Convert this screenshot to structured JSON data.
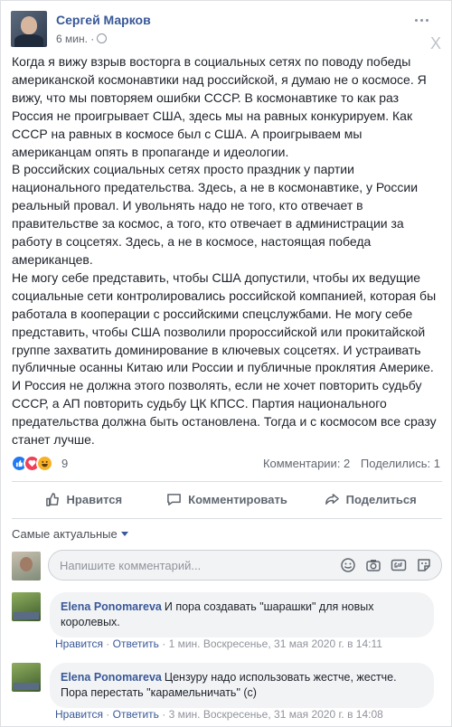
{
  "post": {
    "author": "Сергей Марков",
    "time": "6 мин. ·",
    "text": "Когда я вижу взрыв восторга в социальных сетях по поводу победы\nамериканской космонавтики над российской, я думаю не о космосе. Я\nвижу, что мы повторяем ошибки СССР. В космонавтике то как раз\nРоссия не проигрывает США, здесь мы на равных конкурируем. Как\nСССР на равных в космосе был с США. А проигрываем мы\nамериканцам опять в пропаганде и идеологии.\nВ российских социальных сетях просто праздник у партии\nнационального предательства. Здесь, а не в космонавтике, у России\nреальный провал. И увольнять надо не того, кто отвечает в\nправительстве за космос, а того, кто отвечает в администрации за\nработу в соцсетях. Здесь, а не в космосе, настоящая победа\nамериканцев.\nНе могу себе представить, чтобы США допустили, чтобы их ведущие\nсоциальные сети контролировались российской компанией, которая бы\nработала в кооперации с российскими спецслужбами. Не могу себе\nпредставить, чтобы США позволили пророссийской или прокитайской\nгруппе захватить доминирование в ключевых соцсетях. И устраивать\nпубличные осанны Китаю или России и публичные проклятия Америке.\nИ Россия не должна этого позволять, если не хочет повторить судьбу\nСССР, а АП повторить судьбу ЦК КПСС. Партия национального\nпредательства должна быть остановлена. Тогда и с космосом все сразу\nстанет лучше.",
    "close_glyph": "X",
    "reaction_count": "9",
    "comments_count": "Комментарии: 2",
    "shares_count": "Поделились: 1"
  },
  "actions": {
    "like": "Нравится",
    "comment": "Комментировать",
    "share": "Поделиться"
  },
  "comments_section": {
    "sort_label": "Самые актуальные",
    "input_placeholder": "Напишите комментарий..."
  },
  "comments": [
    {
      "author": "Elena Ponomareva",
      "text": "И пора создавать \"шарашки\" для новых королевых.",
      "like": "Нравится",
      "reply": "Ответить",
      "meta": "1 мин. Воскресенье, 31 мая 2020 г. в 14:11"
    },
    {
      "author": "Elena Ponomareva",
      "text": "Цензуру надо использовать жестче, жестче. Пора перестать \"карамельничать\" (с)",
      "like": "Нравится",
      "reply": "Ответить",
      "meta": "3 мин. Воскресенье, 31 мая 2020 г. в 14:08"
    }
  ],
  "colors": {
    "link": "#385898",
    "muted": "#616770",
    "bubble": "#f2f3f5",
    "like": "#2078f4",
    "love": "#f33e58",
    "haha": "#f7b125"
  }
}
